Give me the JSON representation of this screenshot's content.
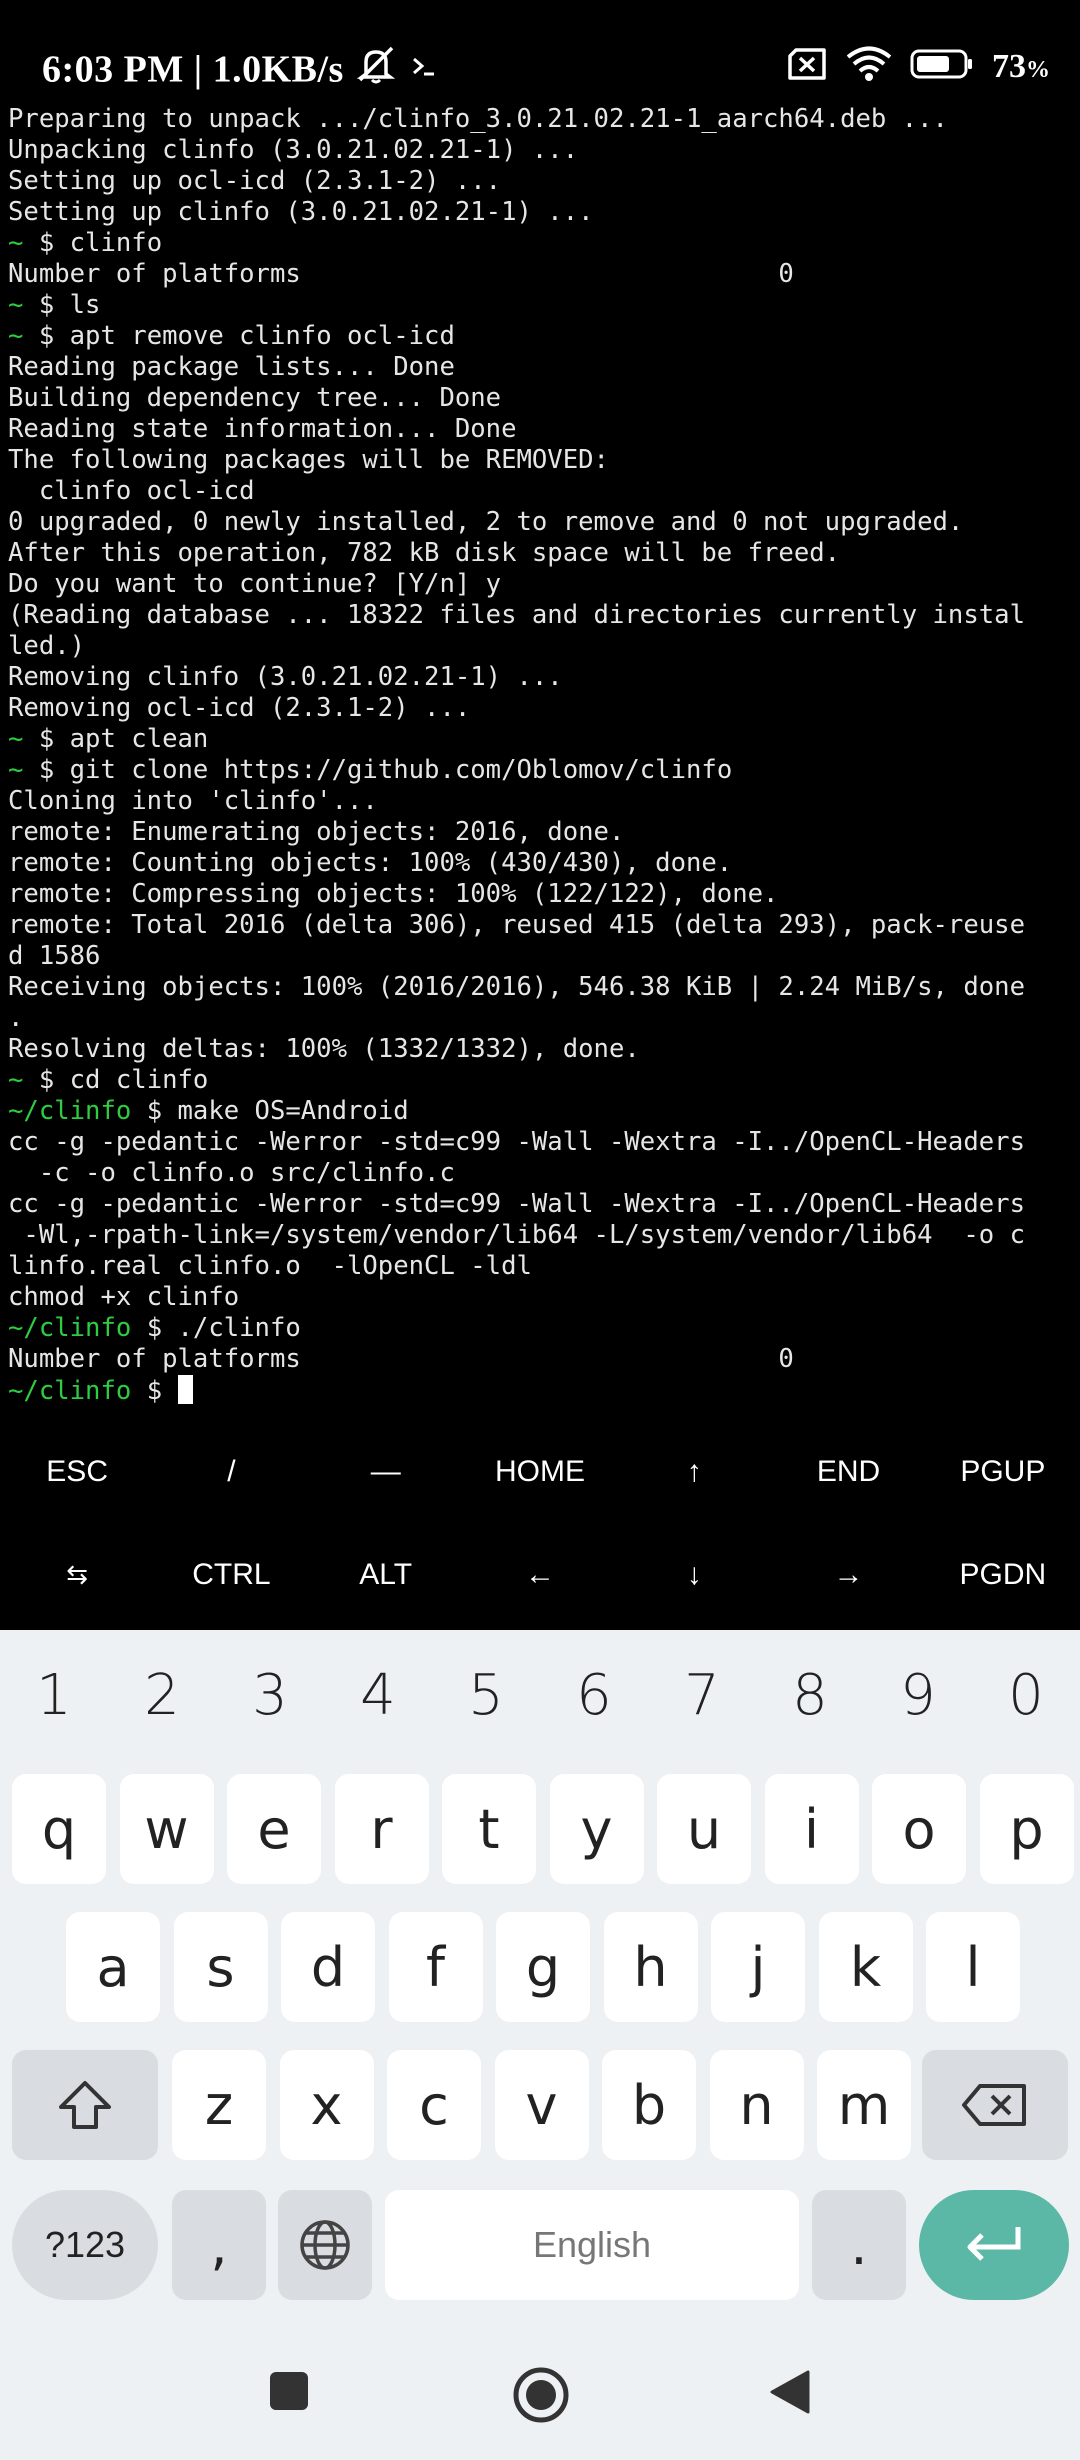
{
  "status_bar": {
    "time_speed": "6:03 PM | 1.0KB/s",
    "battery_percent": "73",
    "battery_unit": "%",
    "battery_level": 0.73,
    "icons": [
      "mute-icon",
      "terminal-icon",
      "sim-off-icon",
      "wifi-icon",
      "battery-icon"
    ]
  },
  "terminal": {
    "lines": [
      {
        "prompt": "",
        "text": "Preparing to unpack .../clinfo_3.0.21.02.21-1_aarch64.deb ..."
      },
      {
        "prompt": "",
        "text": "Unpacking clinfo (3.0.21.02.21-1) ..."
      },
      {
        "prompt": "",
        "text": "Setting up ocl-icd (2.3.1-2) ..."
      },
      {
        "prompt": "",
        "text": "Setting up clinfo (3.0.21.02.21-1) ..."
      },
      {
        "prompt": "~",
        "text": " $ clinfo"
      },
      {
        "prompt": "",
        "text": "Number of platforms                               0"
      },
      {
        "prompt": "~",
        "text": " $ ls"
      },
      {
        "prompt": "~",
        "text": " $ apt remove clinfo ocl-icd"
      },
      {
        "prompt": "",
        "text": "Reading package lists... Done"
      },
      {
        "prompt": "",
        "text": "Building dependency tree... Done"
      },
      {
        "prompt": "",
        "text": "Reading state information... Done"
      },
      {
        "prompt": "",
        "text": "The following packages will be REMOVED:"
      },
      {
        "prompt": "",
        "text": "  clinfo ocl-icd"
      },
      {
        "prompt": "",
        "text": "0 upgraded, 0 newly installed, 2 to remove and 0 not upgraded."
      },
      {
        "prompt": "",
        "text": "After this operation, 782 kB disk space will be freed."
      },
      {
        "prompt": "",
        "text": "Do you want to continue? [Y/n] y"
      },
      {
        "prompt": "",
        "text": "(Reading database ... 18322 files and directories currently instal"
      },
      {
        "prompt": "",
        "text": "led.)"
      },
      {
        "prompt": "",
        "text": "Removing clinfo (3.0.21.02.21-1) ..."
      },
      {
        "prompt": "",
        "text": "Removing ocl-icd (2.3.1-2) ..."
      },
      {
        "prompt": "~",
        "text": " $ apt clean"
      },
      {
        "prompt": "~",
        "text": " $ git clone https://github.com/Oblomov/clinfo"
      },
      {
        "prompt": "",
        "text": "Cloning into 'clinfo'..."
      },
      {
        "prompt": "",
        "text": "remote: Enumerating objects: 2016, done."
      },
      {
        "prompt": "",
        "text": "remote: Counting objects: 100% (430/430), done."
      },
      {
        "prompt": "",
        "text": "remote: Compressing objects: 100% (122/122), done."
      },
      {
        "prompt": "",
        "text": "remote: Total 2016 (delta 306), reused 415 (delta 293), pack-reuse"
      },
      {
        "prompt": "",
        "text": "d 1586"
      },
      {
        "prompt": "",
        "text": "Receiving objects: 100% (2016/2016), 546.38 KiB | 2.24 MiB/s, done"
      },
      {
        "prompt": "",
        "text": "."
      },
      {
        "prompt": "",
        "text": "Resolving deltas: 100% (1332/1332), done."
      },
      {
        "prompt": "~",
        "text": " $ cd clinfo"
      },
      {
        "prompt": "~/clinfo",
        "text": " $ make OS=Android"
      },
      {
        "prompt": "",
        "text": "cc -g -pedantic -Werror -std=c99 -Wall -Wextra -I../OpenCL-Headers"
      },
      {
        "prompt": "",
        "text": "  -c -o clinfo.o src/clinfo.c"
      },
      {
        "prompt": "",
        "text": "cc -g -pedantic -Werror -std=c99 -Wall -Wextra -I../OpenCL-Headers"
      },
      {
        "prompt": "",
        "text": " -Wl,-rpath-link=/system/vendor/lib64 -L/system/vendor/lib64  -o c"
      },
      {
        "prompt": "",
        "text": "linfo.real clinfo.o  -lOpenCL -ldl"
      },
      {
        "prompt": "",
        "text": "chmod +x clinfo"
      },
      {
        "prompt": "~/clinfo",
        "text": " $ ./clinfo"
      },
      {
        "prompt": "",
        "text": "Number of platforms                               0"
      },
      {
        "prompt": "~/clinfo",
        "text": " $ ",
        "cursor": true
      }
    ]
  },
  "extra_keys": {
    "row1": [
      "ESC",
      "/",
      "—",
      "HOME",
      "↑",
      "END",
      "PGUP"
    ],
    "row2": [
      "⇆",
      "CTRL",
      "ALT",
      "←",
      "↓",
      "→",
      "PGDN"
    ]
  },
  "keyboard": {
    "numbers": [
      "1",
      "2",
      "3",
      "4",
      "5",
      "6",
      "7",
      "8",
      "9",
      "0"
    ],
    "row1": [
      "q",
      "w",
      "e",
      "r",
      "t",
      "y",
      "u",
      "i",
      "o",
      "p"
    ],
    "row2": [
      "a",
      "s",
      "d",
      "f",
      "g",
      "h",
      "j",
      "k",
      "l"
    ],
    "row3": [
      "z",
      "x",
      "c",
      "v",
      "b",
      "n",
      "m"
    ],
    "symbols_label": "?123",
    "comma_label": ",",
    "space_label": "English",
    "period_label": ".",
    "enter_color": "#5cb8a6"
  },
  "colors": {
    "prompt": "#2ecc40",
    "terminal_bg": "#000000",
    "keyboard_bg": "#eef1f4"
  }
}
